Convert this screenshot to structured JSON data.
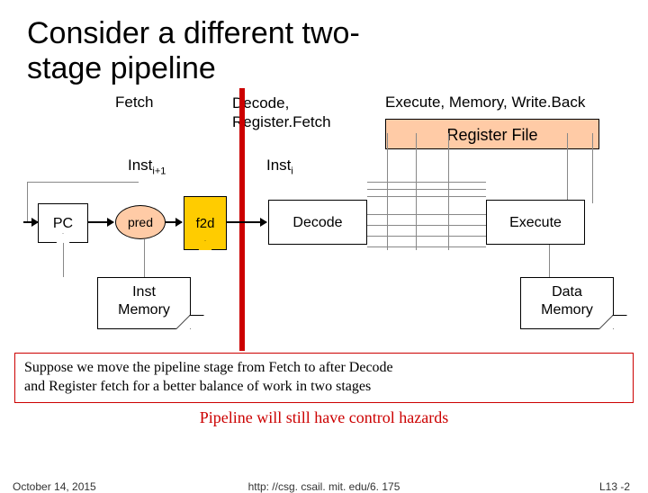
{
  "title_line1": "Consider a different two-",
  "title_line2": "stage pipeline",
  "stages": {
    "fetch": "Fetch",
    "decode_l1": "Decode,",
    "decode_l2": "Register.Fetch",
    "execute": "Execute, Memory, Write.Back"
  },
  "registerFile": "Register File",
  "inst_next": "Inst",
  "inst_next_sub": "i+1",
  "inst_cur": "Inst",
  "inst_cur_sub": "i",
  "blocks": {
    "pc": "PC",
    "pred": "pred",
    "f2d": "f2d",
    "decode": "Decode",
    "execute": "Execute",
    "imem_l1": "Inst",
    "imem_l2": "Memory",
    "dmem_l1": "Data",
    "dmem_l2": "Memory"
  },
  "caption1_l1": "Suppose we move the pipeline stage from Fetch to after Decode",
  "caption1_l2": "and Register fetch for a better balance of work in two stages",
  "caption2": "Pipeline will still have control  hazards",
  "footer": {
    "date": "October 14, 2015",
    "url": "http: //csg. csail. mit. edu/6. 175",
    "page": "L13 -2"
  }
}
